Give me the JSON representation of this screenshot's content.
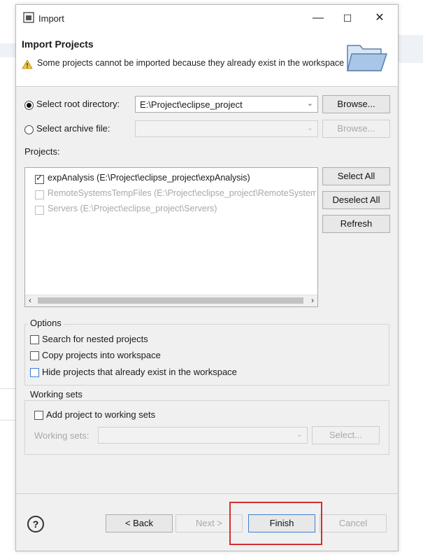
{
  "window": {
    "title": "Import",
    "minimize": "—",
    "maximize": "☐",
    "close": "✕"
  },
  "header": {
    "title": "Import Projects",
    "message": "Some projects cannot be imported because they already exist in the workspace"
  },
  "root_dir": {
    "label": "Select root directory:",
    "value": "E:\\Project\\eclipse_project",
    "browse": "Browse..."
  },
  "archive": {
    "label": "Select archive file:",
    "value": "",
    "browse": "Browse..."
  },
  "projects": {
    "label": "Projects:",
    "items": [
      {
        "label": "expAnalysis (E:\\Project\\eclipse_project\\expAnalysis)",
        "checked": true,
        "enabled": true
      },
      {
        "label": "RemoteSystemsTempFiles (E:\\Project\\eclipse_project\\RemoteSystemsTempFiles)",
        "checked": false,
        "enabled": false
      },
      {
        "label": "Servers (E:\\Project\\eclipse_project\\Servers)",
        "checked": false,
        "enabled": false
      }
    ],
    "select_all": "Select All",
    "deselect_all": "Deselect All",
    "refresh": "Refresh"
  },
  "options": {
    "title": "Options",
    "nested": "Search for nested projects",
    "copy": "Copy projects into workspace",
    "hide": "Hide projects that already exist in the workspace"
  },
  "working_sets": {
    "title": "Working sets",
    "add": "Add project to working sets",
    "label": "Working sets:",
    "select": "Select..."
  },
  "footer": {
    "help": "?",
    "back": "< Back",
    "next": "Next >",
    "finish": "Finish",
    "cancel": "Cancel"
  },
  "colors": {
    "highlight": "#d32f2f",
    "accent": "#3f7fd0"
  }
}
